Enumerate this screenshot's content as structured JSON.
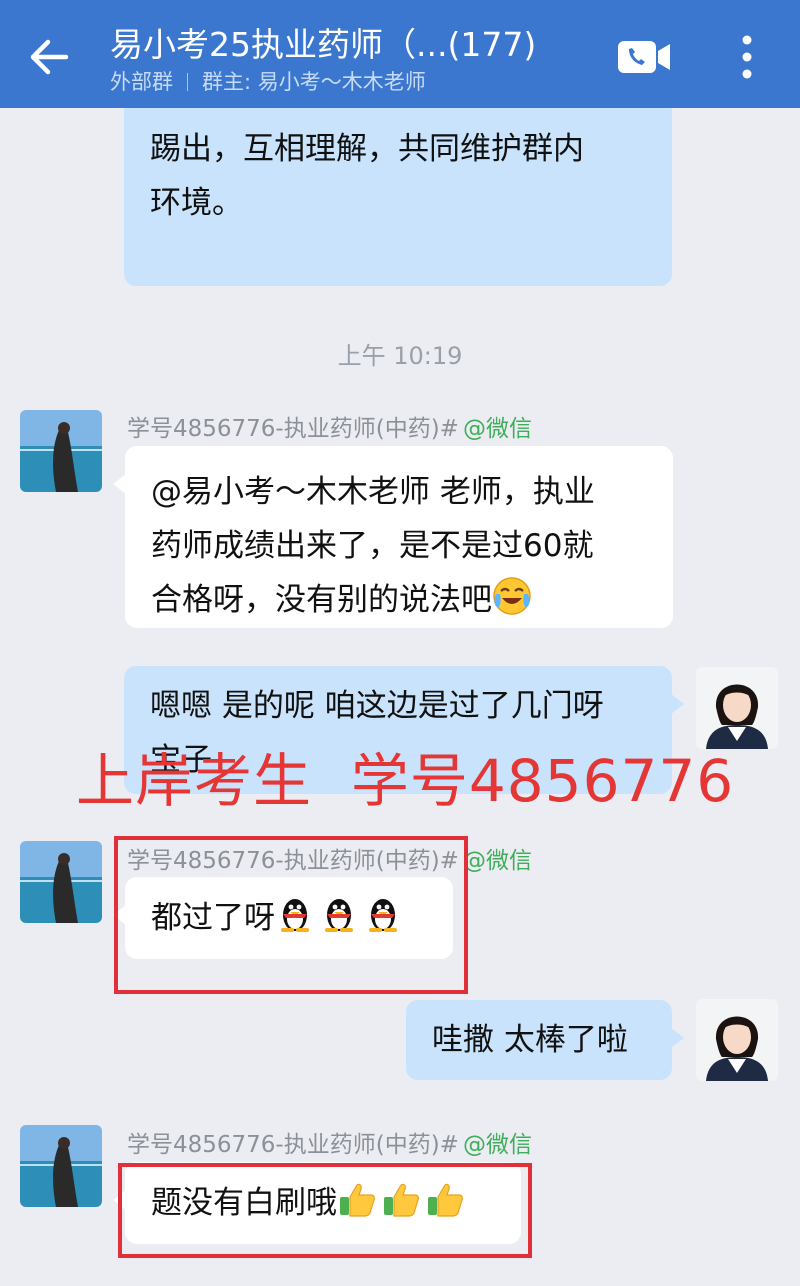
{
  "header": {
    "title": "易小考25执业药师（...(177)",
    "group_type": "外部群",
    "owner": "群主: 易小考～木木老师",
    "icons": {
      "back": "back-arrow-icon",
      "call": "video-call-icon",
      "more": "more-vertical-icon"
    }
  },
  "messages": {
    "m1": {
      "text": "踢出，互相理解，共同维护群内\n环境。"
    },
    "timestamp": "上午 10:19",
    "m2": {
      "sender": "学号4856776-执业药师(中药)#",
      "source": "@微信",
      "text": "@易小考～木木老师 老师，执业\n药师成绩出来了，是不是过60就\n合格呀，没有别的说法吧"
    },
    "m3": {
      "text": "嗯嗯 是的呢 咱这边是过了几门呀\n宝子"
    },
    "m4": {
      "sender": "学号4856776-执业药师(中药)#",
      "source": "@微信",
      "text": "都过了呀"
    },
    "m5": {
      "text": "哇撒 太棒了啦"
    },
    "m6": {
      "sender": "学号4856776-执业药师(中药)#",
      "source": "@微信",
      "text": "题没有白刷哦"
    }
  },
  "watermark": "上岸考生  学号4856776",
  "colors": {
    "header": "#3b77cf",
    "my_bubble": "#c8e3fb",
    "highlight": "#e0313a",
    "watermark": "#e53636",
    "source_tag": "#3fae5a"
  }
}
